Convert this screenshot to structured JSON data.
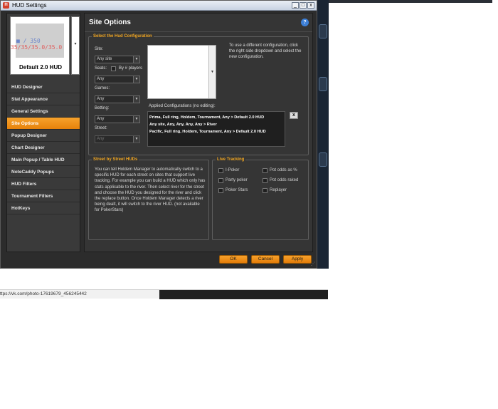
{
  "window": {
    "title": "HUD Settings",
    "app_icon": "hm-app-icon",
    "controls": [
      "_",
      "□",
      "x"
    ]
  },
  "preview": {
    "line1": "■ / 350",
    "line2": "35/35/35.0/35.0",
    "label": "Default 2.0 HUD",
    "dropdown_arrow": "▾"
  },
  "nav": {
    "items": [
      {
        "label": "HUD Designer",
        "active": false
      },
      {
        "label": "Stat Appearance",
        "active": false
      },
      {
        "label": "General Settings",
        "active": false
      },
      {
        "label": "Site Options",
        "active": true
      },
      {
        "label": "Popup Designer",
        "active": false
      },
      {
        "label": "Chart Designer",
        "active": false
      },
      {
        "label": "Main Popup / Table HUD",
        "active": false
      },
      {
        "label": "NoteCaddy Popups",
        "active": false
      },
      {
        "label": "HUD Filters",
        "active": false
      },
      {
        "label": "Tournament Filters",
        "active": false
      },
      {
        "label": "HotKeys",
        "active": false
      }
    ]
  },
  "main": {
    "title": "Site Options",
    "help_icon": "?",
    "select_group": {
      "title": "Select the Hud Configuration",
      "site_label": "Site:",
      "site_value": "Any site",
      "seats_label": "Seats:",
      "by_players_label": "By # players",
      "seats_value": "Any",
      "games_label": "Games:",
      "games_value": "Any",
      "betting_label": "Betting:",
      "betting_value": "Any",
      "street_label": "Street:",
      "street_value": "Any",
      "info_text": "To use a different configuration, click the right side dropdown and select the new configuration.",
      "applied_label": "Applied Configurations (no editing):",
      "applied_rows": [
        "Prima, Full ring, Holdem, Tournament, Any > Default 2.0 HUD",
        "Any site, Any, Any, Any, Any > River",
        "Pacific, Full ring, Holdem, Tournament, Any > Default 2.0 HUD"
      ],
      "remove_label": "x"
    },
    "street_group": {
      "title": "Street by Street HUDs",
      "text": "You can tell Holdem Manager to automatically switch to a specific HUD for each street on sites that support live tracking. For example you can build a HUD which only has stats applicable to the river. Then select river for the street and choose the HUD you designed for the river and click the replace button. Once Holdem Manager detects a river being dealt, it will switch to the river HUD. (not available for PokerStars)"
    },
    "live_group": {
      "title": "Live Tracking",
      "left_items": [
        "I-Poker",
        "Party poker",
        "Poker Stars"
      ],
      "right_items": [
        "Pot odds as %",
        "Pot odds raked",
        "Replayer"
      ]
    }
  },
  "footer": {
    "ok": "OK",
    "cancel": "Cancel",
    "apply": "Apply"
  },
  "statusbar": {
    "url": "ttps://vk.com/photo-17619679_456245442"
  }
}
